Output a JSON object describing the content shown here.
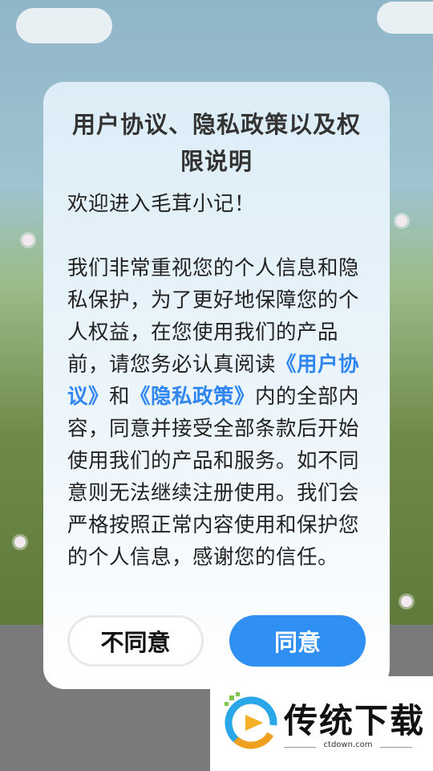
{
  "dialog": {
    "title": "用户协议、隐私政策以及权限说明",
    "welcome": "欢迎进入毛茸小记！",
    "body_part1": "我们非常重视您的个人信息和隐私保护，为了更好地保障您的个人权益，在您使用我们的产品前，请您务必认真阅读",
    "user_agreement_link": "《用户协议》",
    "and_text": "和",
    "privacy_policy_link": "《隐私政策》",
    "body_part2": "内的全部内容，同意并接受全部条款后开始使用我们的产品和服务。如不同意则无法继续注册使用。我们会严格按照正常内容使用和保护您的个人信息，感谢您的信任。",
    "disagree_label": "不同意",
    "agree_label": "同意"
  },
  "watermark": {
    "brand": "传统下载",
    "url": "ctdown.com"
  },
  "colors": {
    "link": "#2f86f2",
    "agree_button": "#2f8ff2"
  }
}
